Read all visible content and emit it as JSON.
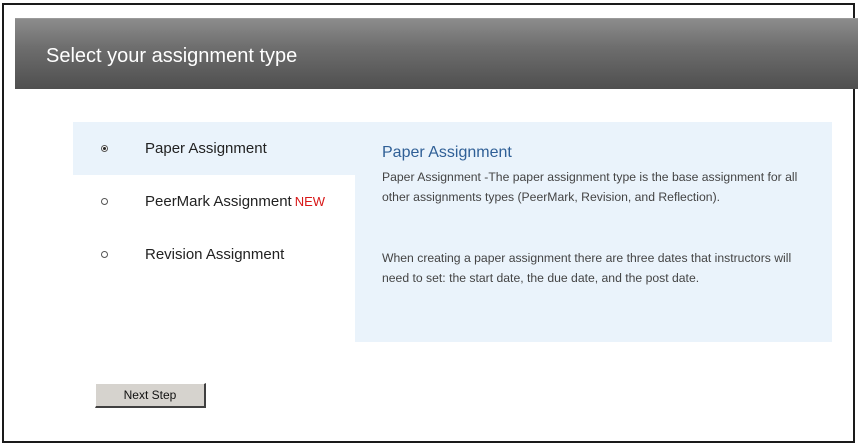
{
  "header": {
    "title": "Select your assignment type"
  },
  "options": [
    {
      "label": "Paper Assignment",
      "badge": "",
      "selected": true
    },
    {
      "label": "PeerMark Assignment",
      "badge": "NEW",
      "selected": false
    },
    {
      "label": "Revision Assignment",
      "badge": "",
      "selected": false
    }
  ],
  "description": {
    "title": "Paper Assignment",
    "paragraph1": "Paper Assignment -The paper assignment type is the base assignment for all other assignments types (PeerMark, Revision, and Reflection).",
    "paragraph2": "When creating a paper assignment there are three dates that instructors will need to set: the start date, the due date, and the post date."
  },
  "actions": {
    "next_label": "Next Step"
  },
  "colors": {
    "badge": "#d81818",
    "panel": "#eaf3fb",
    "title": "#2f5f96"
  }
}
